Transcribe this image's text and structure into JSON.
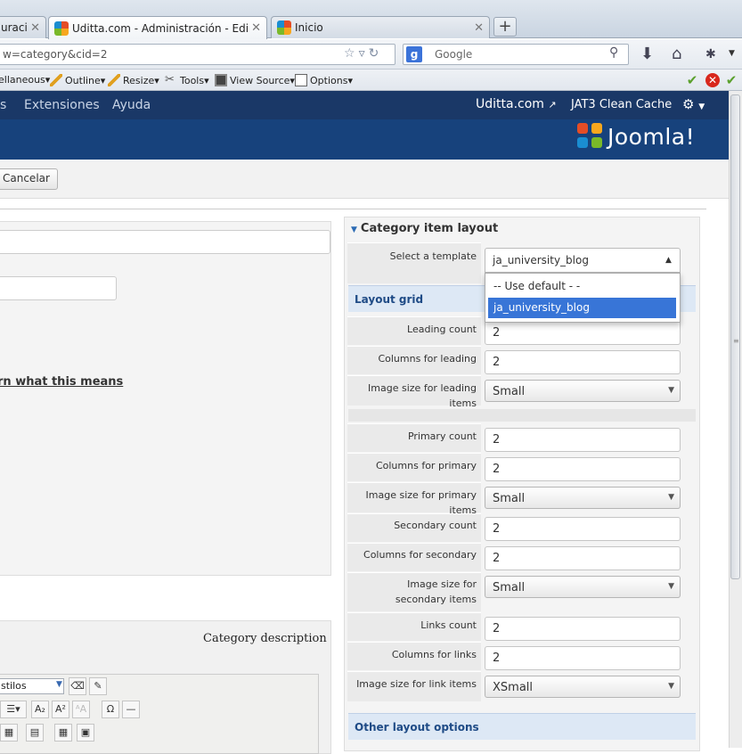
{
  "browser": {
    "tabs": [
      {
        "title": "uraci...",
        "close": "✕"
      },
      {
        "title": "Uditta.com - Administración - Edit category",
        "close": "✕"
      },
      {
        "title": "Inicio",
        "close": "✕"
      }
    ],
    "new_tab": "+",
    "url": "w=category&cid=2",
    "search_engine_icon": "google-icon",
    "search_placeholder": "Google",
    "bookmarks": [
      {
        "label": "ellaneous▾"
      },
      {
        "label": "Outline▾"
      },
      {
        "label": "Resize▾"
      },
      {
        "label": "Tools▾"
      },
      {
        "label": "View Source▾"
      },
      {
        "label": "Options▾"
      }
    ]
  },
  "admin": {
    "menu_left": [
      "s",
      "Extensiones",
      "Ayuda"
    ],
    "site_link": "Uditta.com",
    "site_link_icon": "external-link-icon",
    "clean_cache": "JAT3 Clean Cache",
    "settings_icon": "gear-icon",
    "brand": "Joomla!",
    "toolbar": {
      "cancel": "Cancelar"
    }
  },
  "left": {
    "learn_link": "rn what this means",
    "description_label": "Category description",
    "editor_styles": "stilos"
  },
  "right": {
    "title": "Category item layout",
    "template_label": "Select a template",
    "template_value": "ja_university_blog",
    "template_options": [
      "-- Use default - -",
      "ja_university_blog"
    ],
    "layout_grid": "Layout grid",
    "fields_a": [
      {
        "label": "Leading count",
        "value": "2"
      },
      {
        "label": "Columns for leading",
        "value": "2"
      },
      {
        "label": "Image size for leading items",
        "value": "Small"
      }
    ],
    "fields_b": [
      {
        "label": "Primary count",
        "value": "2"
      },
      {
        "label": "Columns for primary",
        "value": "2"
      },
      {
        "label": "Image size for primary items",
        "value": "Small"
      },
      {
        "label": "Secondary count",
        "value": "2"
      },
      {
        "label": "Columns for secondary",
        "value": "2"
      },
      {
        "label": "Image size for secondary items",
        "value": "Small"
      },
      {
        "label": "Links count",
        "value": "2"
      },
      {
        "label": "Columns for links",
        "value": "2"
      },
      {
        "label": "Image size for link items",
        "value": "XSmall"
      }
    ],
    "other_layout": "Other layout options"
  },
  "colors": {
    "topmenu": "#1a3867",
    "subheader": "#17427c",
    "selected_option": "#3875d7",
    "section_header": "#dde8f5"
  }
}
